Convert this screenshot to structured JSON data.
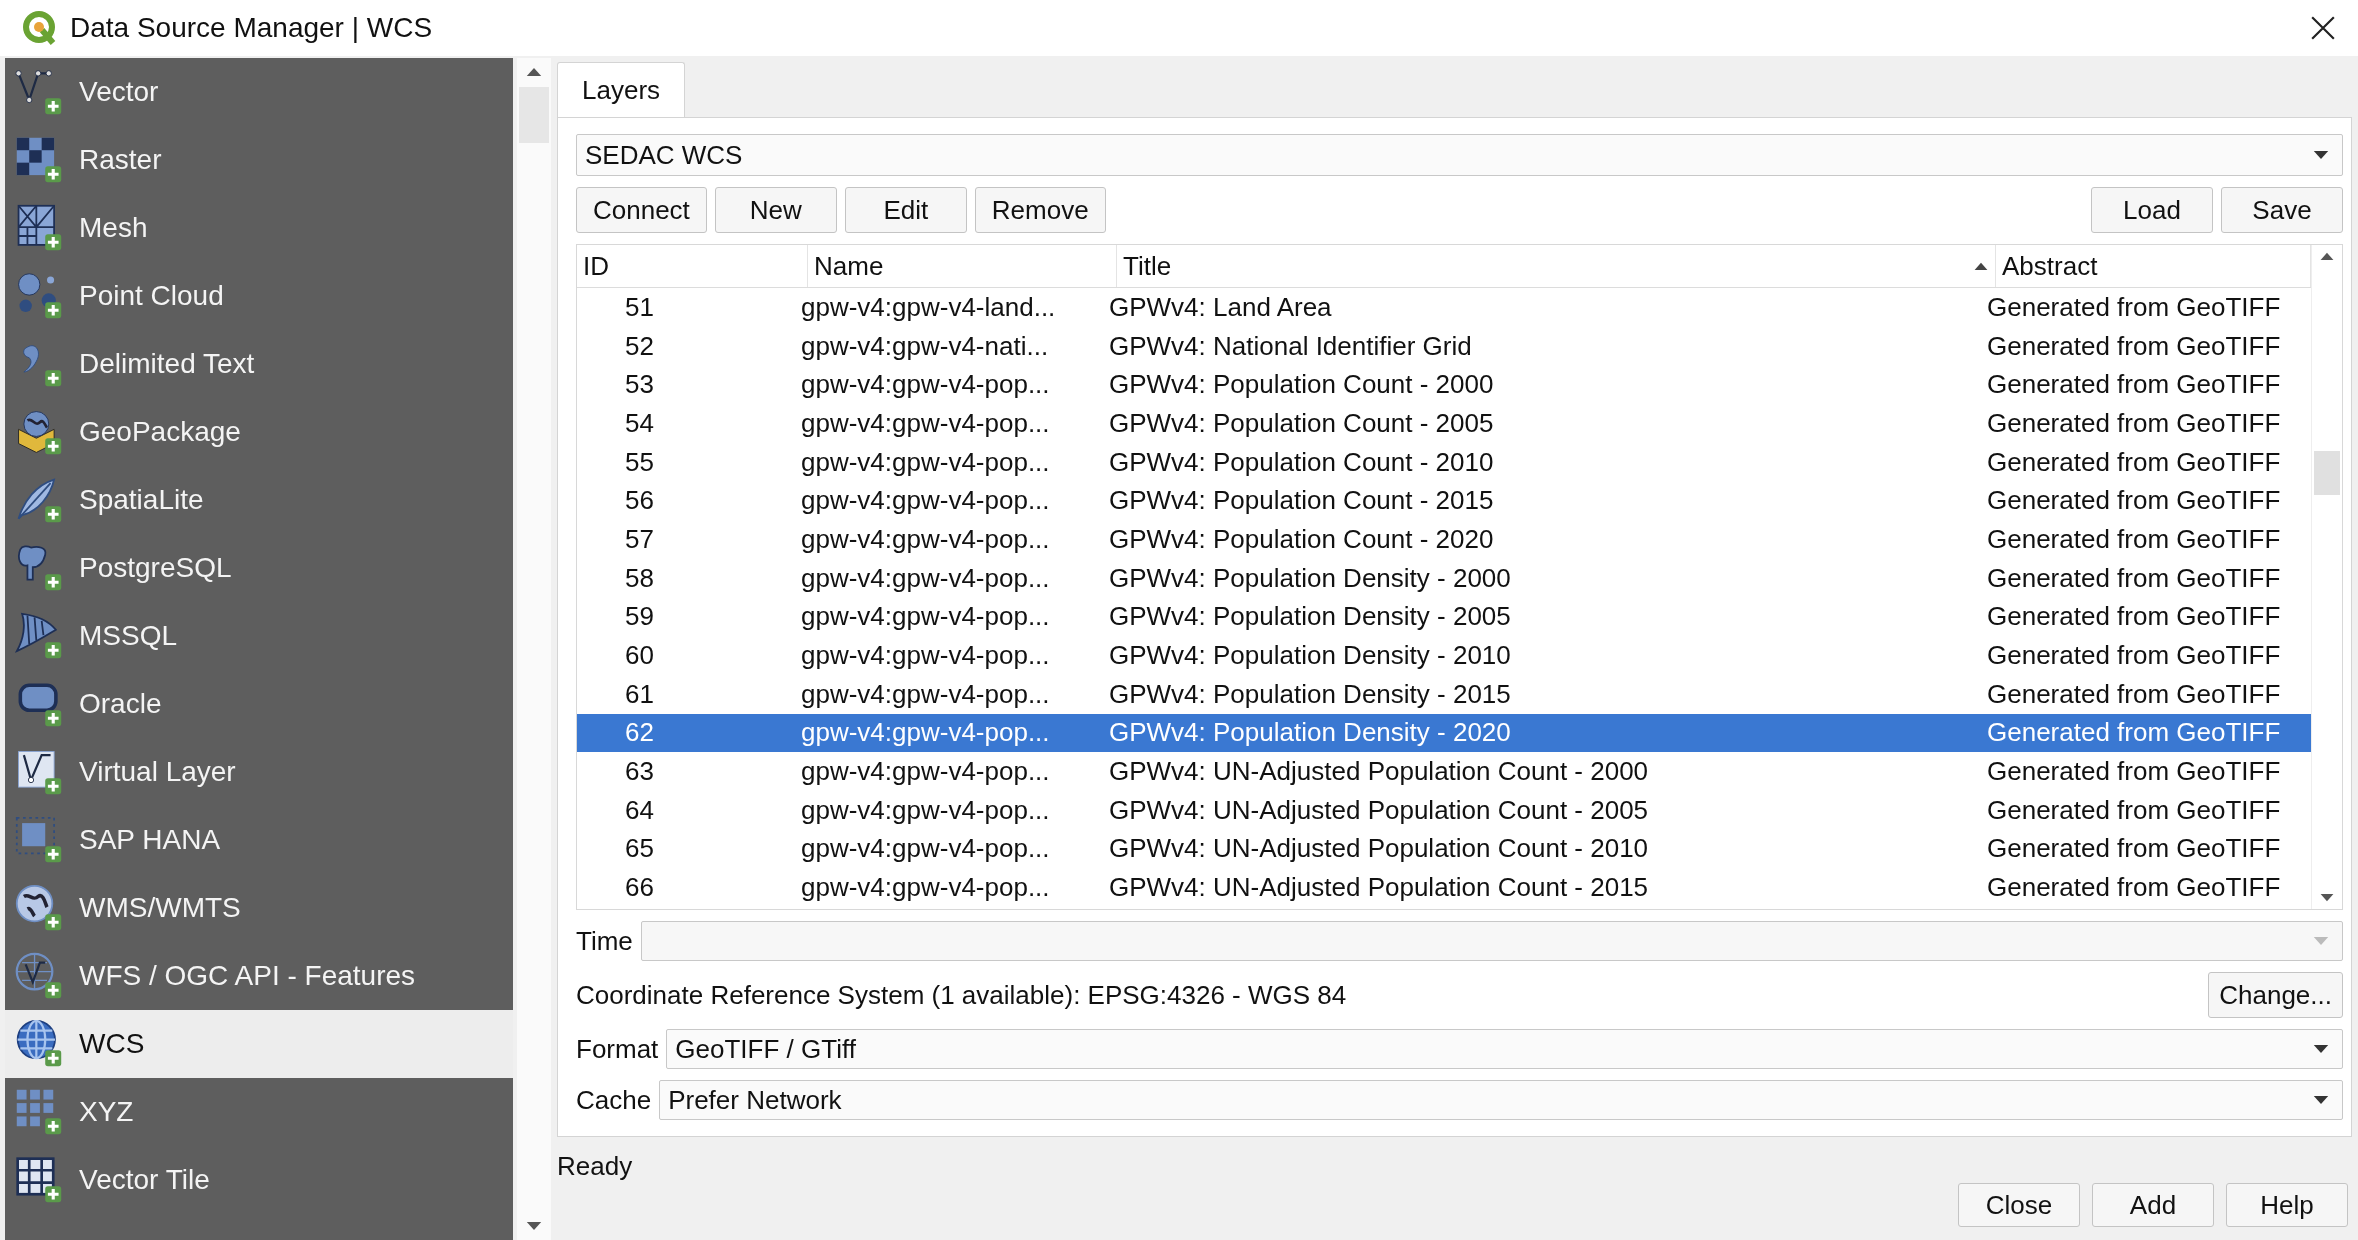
{
  "window": {
    "title": "Data Source Manager | WCS"
  },
  "sidebar": {
    "items": [
      {
        "label": "Vector",
        "selected": false
      },
      {
        "label": "Raster",
        "selected": false
      },
      {
        "label": "Mesh",
        "selected": false
      },
      {
        "label": "Point Cloud",
        "selected": false
      },
      {
        "label": "Delimited Text",
        "selected": false
      },
      {
        "label": "GeoPackage",
        "selected": false
      },
      {
        "label": "SpatiaLite",
        "selected": false
      },
      {
        "label": "PostgreSQL",
        "selected": false
      },
      {
        "label": "MSSQL",
        "selected": false
      },
      {
        "label": "Oracle",
        "selected": false
      },
      {
        "label": "Virtual Layer",
        "selected": false
      },
      {
        "label": "SAP HANA",
        "selected": false
      },
      {
        "label": "WMS/WMTS",
        "selected": false
      },
      {
        "label": "WFS / OGC API - Features",
        "selected": false
      },
      {
        "label": "WCS",
        "selected": true
      },
      {
        "label": "XYZ",
        "selected": false
      },
      {
        "label": "Vector Tile",
        "selected": false
      }
    ]
  },
  "tabs": [
    {
      "label": "Layers",
      "selected": true
    }
  ],
  "connection": {
    "value": "SEDAC WCS"
  },
  "connection_buttons": [
    "Connect",
    "New",
    "Edit",
    "Remove"
  ],
  "file_buttons": [
    "Load",
    "Save"
  ],
  "table": {
    "columns": [
      {
        "label": "ID",
        "sorted": false
      },
      {
        "label": "Name",
        "sorted": false
      },
      {
        "label": "Title",
        "sorted": true
      },
      {
        "label": "Abstract",
        "sorted": false
      }
    ],
    "rows": [
      {
        "id": "51",
        "name": "gpw-v4:gpw-v4-land...",
        "title": "GPWv4: Land Area",
        "abstract": "Generated from GeoTIFF",
        "selected": false
      },
      {
        "id": "52",
        "name": "gpw-v4:gpw-v4-nati...",
        "title": "GPWv4: National Identifier Grid",
        "abstract": "Generated from GeoTIFF",
        "selected": false
      },
      {
        "id": "53",
        "name": "gpw-v4:gpw-v4-pop...",
        "title": "GPWv4: Population Count - 2000",
        "abstract": "Generated from GeoTIFF",
        "selected": false
      },
      {
        "id": "54",
        "name": "gpw-v4:gpw-v4-pop...",
        "title": "GPWv4: Population Count - 2005",
        "abstract": "Generated from GeoTIFF",
        "selected": false
      },
      {
        "id": "55",
        "name": "gpw-v4:gpw-v4-pop...",
        "title": "GPWv4: Population Count - 2010",
        "abstract": "Generated from GeoTIFF",
        "selected": false
      },
      {
        "id": "56",
        "name": "gpw-v4:gpw-v4-pop...",
        "title": "GPWv4: Population Count - 2015",
        "abstract": "Generated from GeoTIFF",
        "selected": false
      },
      {
        "id": "57",
        "name": "gpw-v4:gpw-v4-pop...",
        "title": "GPWv4: Population Count - 2020",
        "abstract": "Generated from GeoTIFF",
        "selected": false
      },
      {
        "id": "58",
        "name": "gpw-v4:gpw-v4-pop...",
        "title": "GPWv4: Population Density - 2000",
        "abstract": "Generated from GeoTIFF",
        "selected": false
      },
      {
        "id": "59",
        "name": "gpw-v4:gpw-v4-pop...",
        "title": "GPWv4: Population Density - 2005",
        "abstract": "Generated from GeoTIFF",
        "selected": false
      },
      {
        "id": "60",
        "name": "gpw-v4:gpw-v4-pop...",
        "title": "GPWv4: Population Density - 2010",
        "abstract": "Generated from GeoTIFF",
        "selected": false
      },
      {
        "id": "61",
        "name": "gpw-v4:gpw-v4-pop...",
        "title": "GPWv4: Population Density - 2015",
        "abstract": "Generated from GeoTIFF",
        "selected": false
      },
      {
        "id": "62",
        "name": "gpw-v4:gpw-v4-pop...",
        "title": "GPWv4: Population Density - 2020",
        "abstract": "Generated from GeoTIFF",
        "selected": true
      },
      {
        "id": "63",
        "name": "gpw-v4:gpw-v4-pop...",
        "title": "GPWv4: UN-Adjusted Population Count - 2000",
        "abstract": "Generated from GeoTIFF",
        "selected": false
      },
      {
        "id": "64",
        "name": "gpw-v4:gpw-v4-pop...",
        "title": "GPWv4: UN-Adjusted Population Count - 2005",
        "abstract": "Generated from GeoTIFF",
        "selected": false
      },
      {
        "id": "65",
        "name": "gpw-v4:gpw-v4-pop...",
        "title": "GPWv4: UN-Adjusted Population Count - 2010",
        "abstract": "Generated from GeoTIFF",
        "selected": false
      },
      {
        "id": "66",
        "name": "gpw-v4:gpw-v4-pop...",
        "title": "GPWv4: UN-Adjusted Population Count - 2015",
        "abstract": "Generated from GeoTIFF",
        "selected": false
      }
    ]
  },
  "time": {
    "label": "Time",
    "disabled": true
  },
  "crs": {
    "text": "Coordinate Reference System (1 available): EPSG:4326 - WGS 84",
    "button": "Change..."
  },
  "format": {
    "label": "Format",
    "value": "GeoTIFF / GTiff"
  },
  "cache": {
    "label": "Cache",
    "value": "Prefer Network"
  },
  "status": "Ready",
  "dialog_buttons": [
    "Close",
    "Add",
    "Help"
  ]
}
